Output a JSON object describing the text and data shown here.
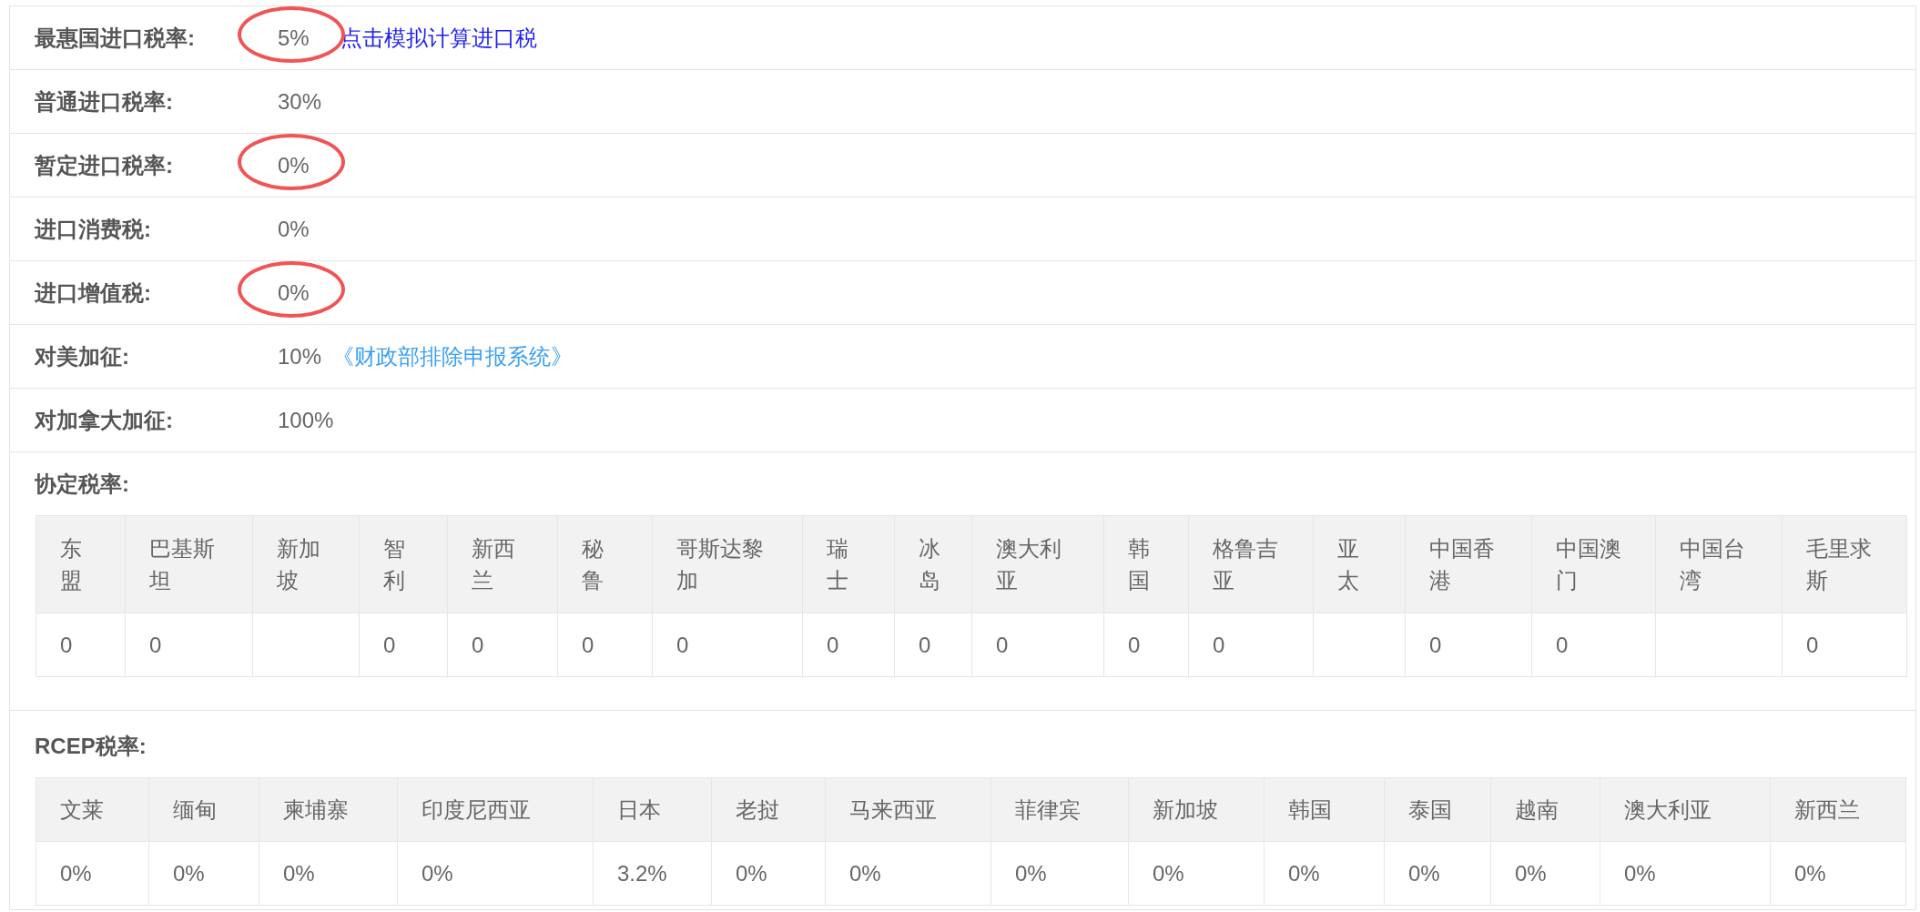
{
  "rate_rows": [
    {
      "label": "最惠国进口税率:",
      "value": "5%",
      "circled": true,
      "link": {
        "text": "点击模拟计算进口税",
        "kind": "action"
      }
    },
    {
      "label": "普通进口税率:",
      "value": "30%",
      "circled": false
    },
    {
      "label": "暂定进口税率:",
      "value": "0%",
      "circled": true
    },
    {
      "label": "进口消费税:",
      "value": "0%",
      "circled": false
    },
    {
      "label": "进口增值税:",
      "value": "0%",
      "circled": true
    },
    {
      "label": "对美加征:",
      "value": "10%",
      "circled": false,
      "link": {
        "text": "《财政部排除申报系统》",
        "kind": "reference"
      }
    },
    {
      "label": "对加拿大加征:",
      "value": "100%",
      "circled": false
    }
  ],
  "agreement_rates": {
    "label": "协定税率:",
    "columns": [
      {
        "header": "东盟",
        "value": "0"
      },
      {
        "header": "巴基斯坦",
        "value": "0"
      },
      {
        "header": "新加坡"
      },
      {
        "header": "智利",
        "value": "0"
      },
      {
        "header": "新西兰",
        "value": "0"
      },
      {
        "header": "秘鲁",
        "value": "0"
      },
      {
        "header": "哥斯达黎加",
        "value": "0"
      },
      {
        "header": "瑞士",
        "value": "0"
      },
      {
        "header": "冰岛",
        "value": "0"
      },
      {
        "header": "澳大利亚",
        "value": "0"
      },
      {
        "header": "韩国",
        "value": "0"
      },
      {
        "header": "格鲁吉亚",
        "value": "0"
      },
      {
        "header": "亚太"
      },
      {
        "header": "中国香港",
        "value": "0"
      },
      {
        "header": "中国澳门",
        "value": "0"
      },
      {
        "header": "中国台湾"
      },
      {
        "header": "毛里求斯",
        "value": "0"
      }
    ]
  },
  "rcep_rates": {
    "label": "RCEP税率:",
    "columns": [
      {
        "header": "文莱",
        "value": "0%"
      },
      {
        "header": "缅甸",
        "value": "0%"
      },
      {
        "header": "柬埔寨",
        "value": "0%"
      },
      {
        "header": "印度尼西亚",
        "value": "0%"
      },
      {
        "header": "日本",
        "value": "3.2%"
      },
      {
        "header": "老挝",
        "value": "0%"
      },
      {
        "header": "马来西亚",
        "value": "0%"
      },
      {
        "header": "菲律宾",
        "value": "0%"
      },
      {
        "header": "新加坡",
        "value": "0%"
      },
      {
        "header": "韩国",
        "value": "0%"
      },
      {
        "header": "泰国",
        "value": "0%"
      },
      {
        "header": "越南",
        "value": "0%"
      },
      {
        "header": "澳大利亚",
        "value": "0%"
      },
      {
        "header": "新西兰",
        "value": "0%"
      }
    ]
  }
}
